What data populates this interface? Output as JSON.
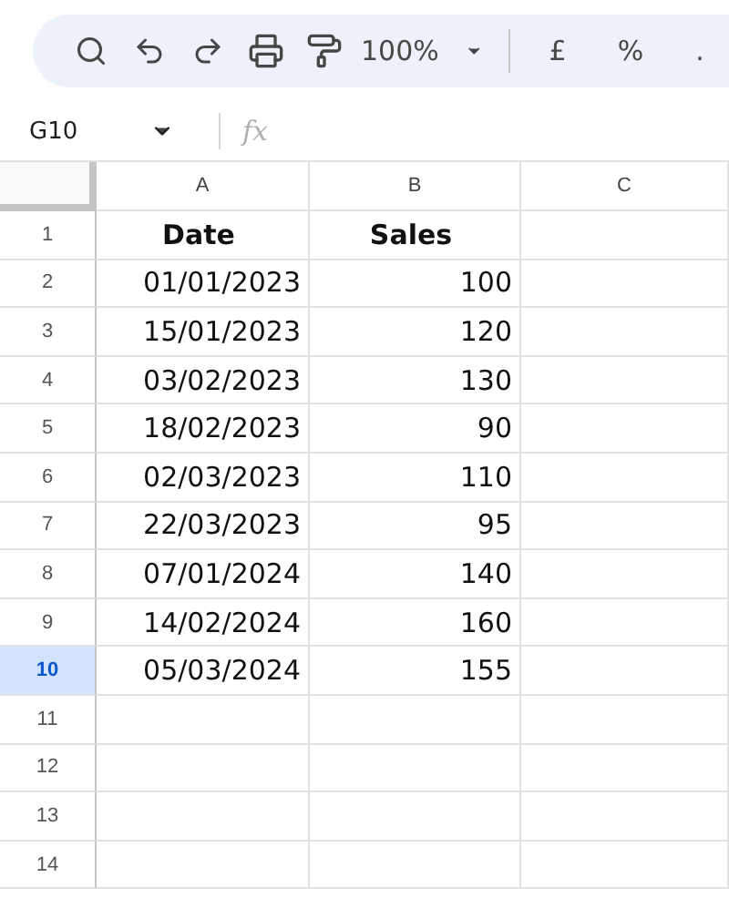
{
  "toolbar": {
    "zoom": "100%",
    "currency": "£",
    "percent": "%",
    "decimal": "."
  },
  "name_box": {
    "value": "G10"
  },
  "formula_bar": {
    "label": "fx"
  },
  "columns": [
    {
      "label": "A"
    },
    {
      "label": "B"
    },
    {
      "label": "C"
    }
  ],
  "rows": [
    {
      "number": "1",
      "selected": false,
      "cells": [
        "Date",
        "Sales",
        ""
      ],
      "header": true
    },
    {
      "number": "2",
      "selected": false,
      "cells": [
        "01/01/2023",
        "100",
        ""
      ]
    },
    {
      "number": "3",
      "selected": false,
      "cells": [
        "15/01/2023",
        "120",
        ""
      ]
    },
    {
      "number": "4",
      "selected": false,
      "cells": [
        "03/02/2023",
        "130",
        ""
      ]
    },
    {
      "number": "5",
      "selected": false,
      "cells": [
        "18/02/2023",
        "90",
        ""
      ]
    },
    {
      "number": "6",
      "selected": false,
      "cells": [
        "02/03/2023",
        "110",
        ""
      ]
    },
    {
      "number": "7",
      "selected": false,
      "cells": [
        "22/03/2023",
        "95",
        ""
      ]
    },
    {
      "number": "8",
      "selected": false,
      "cells": [
        "07/01/2024",
        "140",
        ""
      ]
    },
    {
      "number": "9",
      "selected": false,
      "cells": [
        "14/02/2024",
        "160",
        ""
      ]
    },
    {
      "number": "10",
      "selected": true,
      "cells": [
        "05/03/2024",
        "155",
        ""
      ]
    },
    {
      "number": "11",
      "selected": false,
      "cells": [
        "",
        "",
        ""
      ]
    },
    {
      "number": "12",
      "selected": false,
      "cells": [
        "",
        "",
        ""
      ]
    },
    {
      "number": "13",
      "selected": false,
      "cells": [
        "",
        "",
        ""
      ]
    },
    {
      "number": "14",
      "selected": false,
      "cells": [
        "",
        "",
        ""
      ]
    }
  ]
}
